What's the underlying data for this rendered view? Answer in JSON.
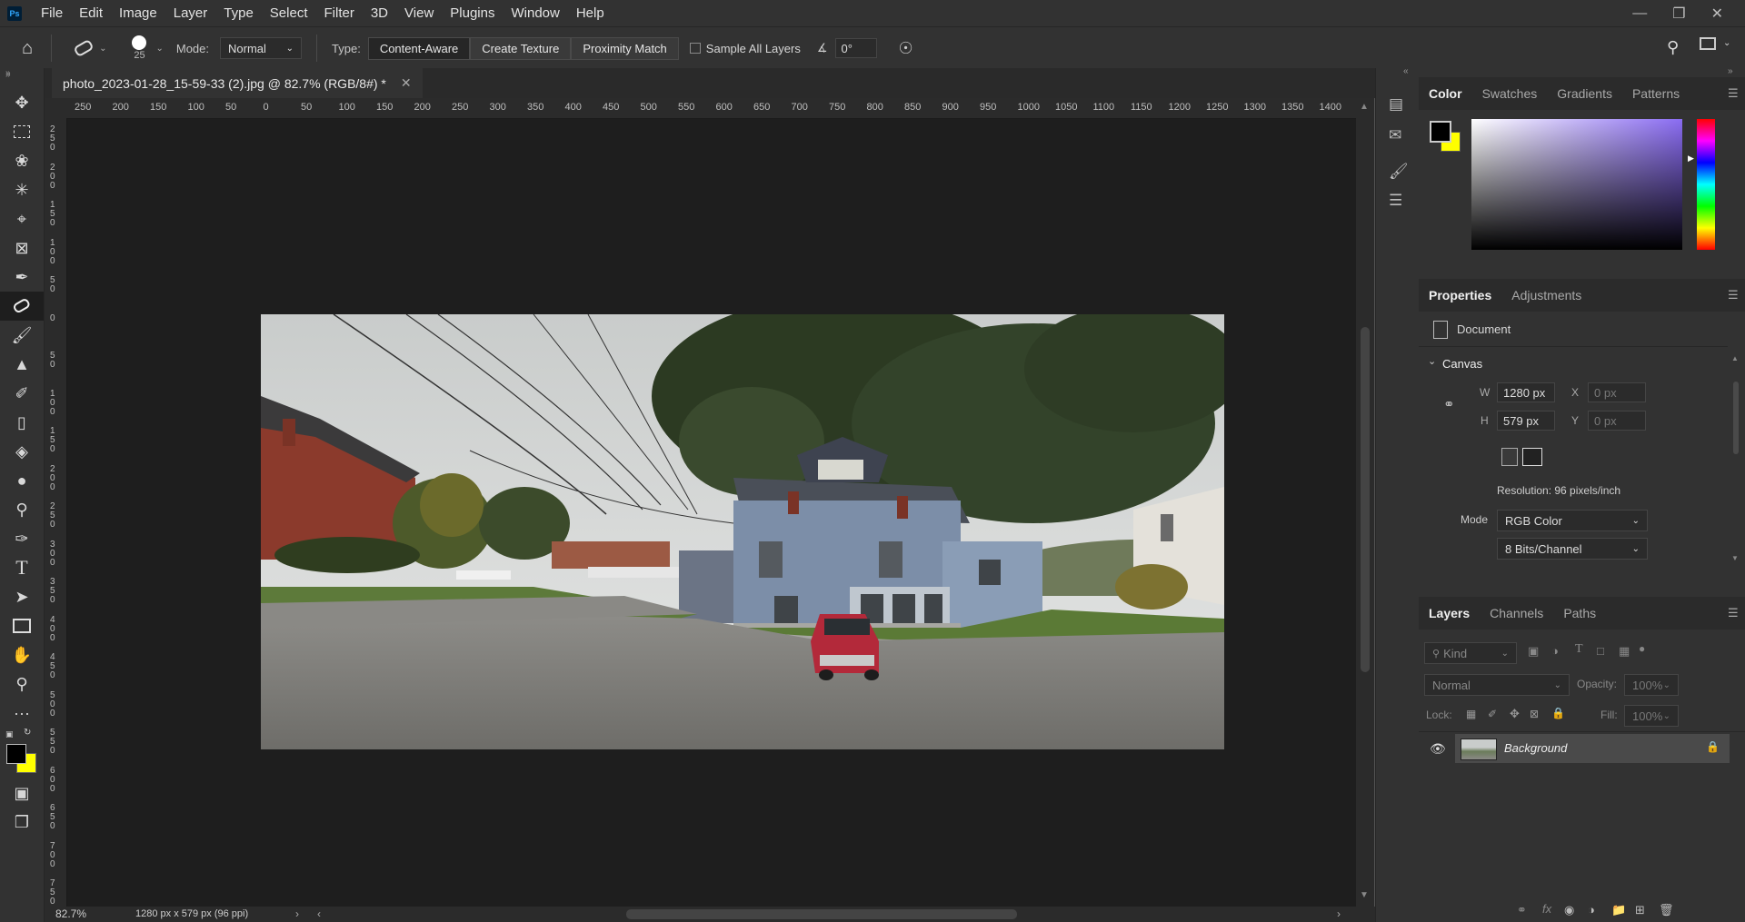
{
  "app": {
    "logo": "Ps"
  },
  "menu": [
    "File",
    "Edit",
    "Image",
    "Layer",
    "Type",
    "Select",
    "Filter",
    "3D",
    "View",
    "Plugins",
    "Window",
    "Help"
  ],
  "options": {
    "brush_size": "25",
    "mode_label": "Mode:",
    "mode_value": "Normal",
    "type_label": "Type:",
    "type_buttons": [
      "Content-Aware",
      "Create Texture",
      "Proximity Match"
    ],
    "sample_all_layers": "Sample All Layers",
    "angle": "0°"
  },
  "document": {
    "tab_title": "photo_2023-01-28_15-59-33 (2).jpg @ 82.7% (RGB/8#) *",
    "zoom": "82.7%",
    "info": "1280 px x 579 px (96 ppi)"
  },
  "rulers": {
    "h": [
      "250",
      "200",
      "150",
      "100",
      "50",
      "0",
      "50",
      "100",
      "150",
      "200",
      "250",
      "300",
      "350",
      "400",
      "450",
      "500",
      "550",
      "600",
      "650",
      "700",
      "750",
      "800",
      "850",
      "900",
      "950",
      "1000",
      "1050",
      "1100",
      "1150",
      "1200",
      "1250",
      "1300",
      "1350",
      "1400"
    ],
    "v": [
      "2\n5\n0",
      "2\n0\n0",
      "1\n5\n0",
      "1\n0\n0",
      "5\n0",
      "0",
      "5\n0",
      "1\n0\n0",
      "1\n5\n0",
      "2\n0\n0",
      "2\n5\n0",
      "3\n0\n0",
      "3\n5\n0",
      "4\n0\n0",
      "4\n5\n0",
      "5\n0\n0",
      "5\n5\n0",
      "6\n0\n0",
      "6\n5\n0",
      "7\n0\n0",
      "7\n5\n0"
    ]
  },
  "color_panel": {
    "tabs": [
      "Color",
      "Swatches",
      "Gradients",
      "Patterns"
    ],
    "foreground": "#000000",
    "background": "#ffff00"
  },
  "properties": {
    "tabs": [
      "Properties",
      "Adjustments"
    ],
    "document_label": "Document",
    "canvas_label": "Canvas",
    "w_label": "W",
    "w_value": "1280 px",
    "h_label": "H",
    "h_value": "579 px",
    "x_label": "X",
    "x_value": "0 px",
    "y_label": "Y",
    "y_value": "0 px",
    "resolution": "Resolution: 96 pixels/inch",
    "mode_label": "Mode",
    "mode_value": "RGB Color",
    "depth_value": "8 Bits/Channel"
  },
  "layers": {
    "tabs": [
      "Layers",
      "Channels",
      "Paths"
    ],
    "filter_placeholder": "Kind",
    "blend_mode": "Normal",
    "opacity_label": "Opacity:",
    "opacity_value": "100%",
    "lock_label": "Lock:",
    "fill_label": "Fill:",
    "fill_value": "100%",
    "items": [
      {
        "name": "Background"
      }
    ]
  }
}
